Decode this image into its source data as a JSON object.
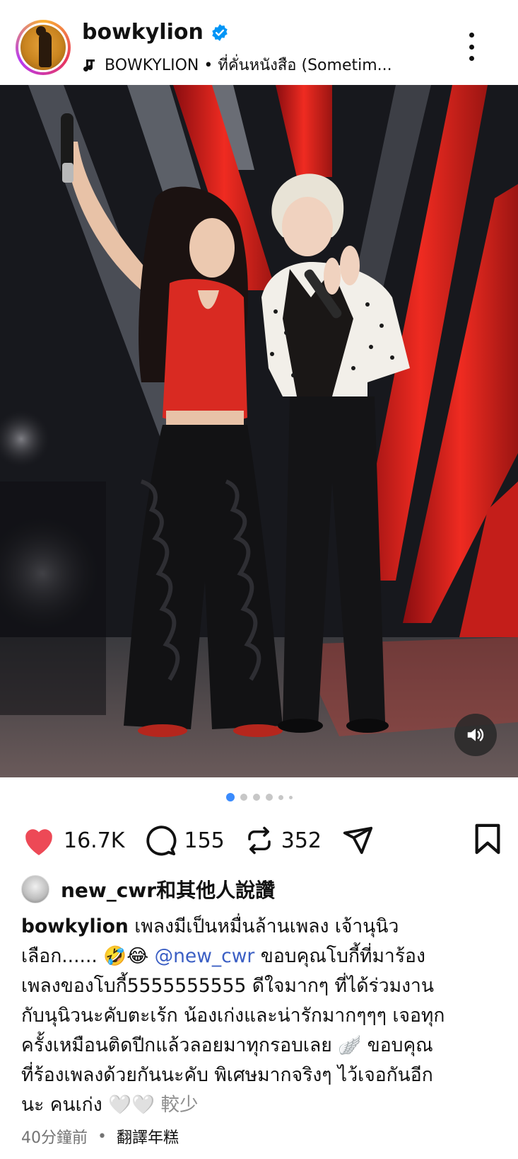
{
  "post": {
    "username": "bowkylion",
    "music": "BOWKYLION • ที่คั่นหนังสือ (Sometim...",
    "likes": "16.7K",
    "comments": "155",
    "reposts": "352",
    "liked_by": "new_cwr和其他人說讚",
    "caption_user": "bowkylion",
    "caption_line1": "เพลงมีเป็นหมื่นล้านเพลง เจ้านุนิว",
    "caption_line2a": "เลือก...... ",
    "caption_emoji1": "🤣😂",
    "caption_mention": "@new_cwr",
    "caption_line2b": " ขอบคุณโบกี้ที่มาร้อง",
    "caption_line3": "เพลงของโบกี้5555555555 ดีใจมากๆ ที่ได้ร่วมงาน",
    "caption_line4": "กับนุนิวนะคับตะเร้ก น้องเก่งและน่ารักมากๆๆๆ เจอทุก",
    "caption_line5a": "ครั้งเหมือนติดปีกแล้วลอยมาทุกรอบเลย ",
    "caption_emoji2": "🪽",
    "caption_line5b": " ขอบคุณ",
    "caption_line6": "ที่ร้องเพลงด้วยกันนะคับ พิเศษมากจริงๆ ไว้เจอกันอีก",
    "caption_line7a": "นะ คนเก่ง ",
    "caption_emoji3": "🤍🤍",
    "caption_more": " 較少",
    "time_ago": "40分鐘前",
    "separator": "•",
    "translate": "翻譯年糕"
  },
  "icons": {
    "verified": "verified-badge-icon",
    "music": "music-note-icon",
    "more": "more-vertical-icon",
    "like": "heart-icon",
    "comment": "comment-icon",
    "repost": "repost-icon",
    "share": "send-icon",
    "save": "bookmark-icon",
    "volume": "volume-icon"
  },
  "colors": {
    "like_red": "#ed4956",
    "mention_blue": "#3b5fc4",
    "verified_blue": "#0095f6",
    "dot_active": "#3a8bfd"
  },
  "carousel": {
    "total": 6,
    "active": 1
  }
}
